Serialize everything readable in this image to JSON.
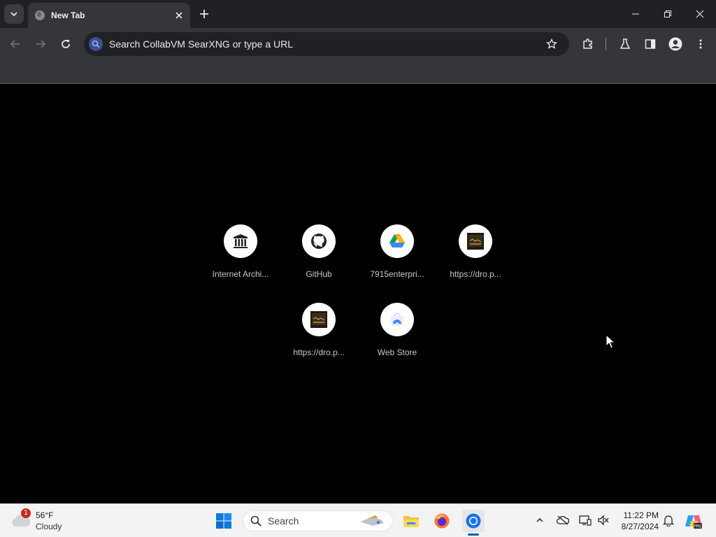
{
  "tab": {
    "title": "New Tab"
  },
  "omnibox": {
    "placeholder": "Search CollabVM SearXNG or type a URL"
  },
  "shortcuts": [
    {
      "label": "Internet Archi...",
      "icon": "archive-icon"
    },
    {
      "label": "GitHub",
      "icon": "github-icon"
    },
    {
      "label": "7915enterpri...",
      "icon": "google-drive-icon"
    },
    {
      "label": "https://dro.p...",
      "icon": "thumbnail-icon"
    },
    {
      "label": "https://dro.p...",
      "icon": "thumbnail-icon"
    },
    {
      "label": "Web Store",
      "icon": "web-store-icon"
    }
  ],
  "taskbar": {
    "weather": {
      "temp": "56°F",
      "condition": "Cloudy",
      "badge": "1"
    },
    "search_label": "Search",
    "time": "11:22 PM",
    "date": "8/27/2024"
  },
  "colors": {
    "accent": "#005fb8",
    "tab_active": "#35363a",
    "frame": "#202124"
  }
}
